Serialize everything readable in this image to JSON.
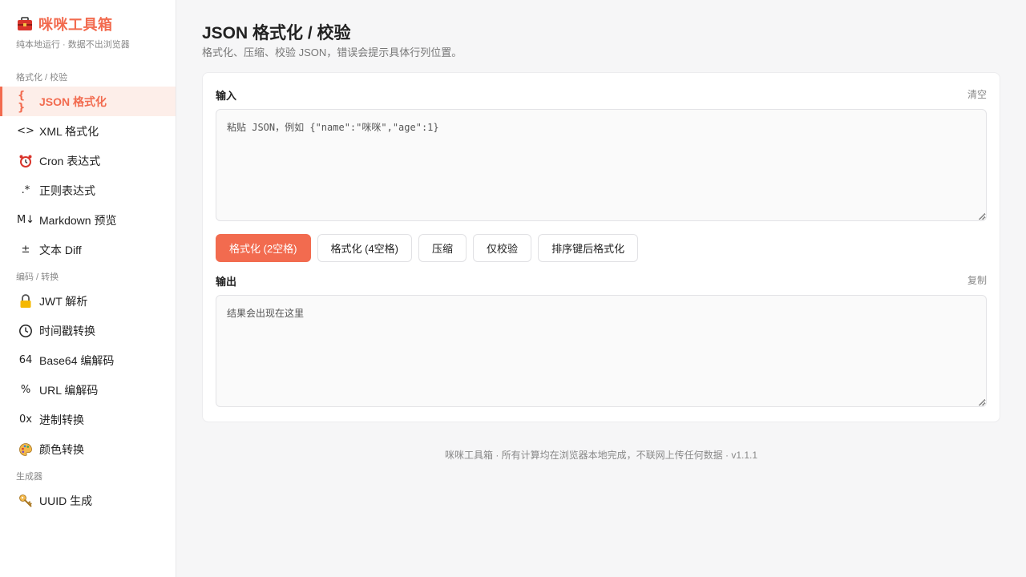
{
  "brand": {
    "title": "咪咪工具箱",
    "subtitle": "纯本地运行 · 数据不出浏览器",
    "icon": "toolbox-icon",
    "accent_color": "#f26b4f"
  },
  "sidebar": {
    "groups": [
      {
        "label": "格式化 / 校验",
        "items": [
          {
            "icon_text": "{ }",
            "icon": "braces-icon",
            "label": "JSON 格式化",
            "active": true
          },
          {
            "icon_text": "<>",
            "icon": "angle-brackets-icon",
            "label": "XML 格式化"
          },
          {
            "icon_text": "⏰",
            "icon": "alarm-clock-icon",
            "label": "Cron 表达式"
          },
          {
            "icon_text": ".*",
            "icon": "regex-icon",
            "label": "正则表达式"
          },
          {
            "icon_text": "M↓",
            "icon": "markdown-icon",
            "label": "Markdown 预览"
          },
          {
            "icon_text": "±",
            "icon": "plus-minus-icon",
            "label": "文本 Diff"
          }
        ]
      },
      {
        "label": "编码 / 转换",
        "items": [
          {
            "icon_text": "🔒",
            "icon": "lock-icon",
            "label": "JWT 解析"
          },
          {
            "icon_text": "🕒",
            "icon": "clock-icon",
            "label": "时间戳转换"
          },
          {
            "icon_text": "64",
            "icon": "base64-icon",
            "label": "Base64 编解码"
          },
          {
            "icon_text": "%",
            "icon": "percent-icon",
            "label": "URL 编解码"
          },
          {
            "icon_text": "0x",
            "icon": "hex-icon",
            "label": "进制转换"
          },
          {
            "icon_text": "🎨",
            "icon": "palette-icon",
            "label": "颜色转换"
          }
        ]
      },
      {
        "label": "生成器",
        "items": [
          {
            "icon_text": "🔑",
            "icon": "key-icon",
            "label": "UUID 生成"
          }
        ]
      }
    ]
  },
  "main": {
    "title": "JSON 格式化 / 校验",
    "description": "格式化、压缩、校验 JSON，错误会提示具体行列位置。",
    "input": {
      "label": "输入",
      "clear_label": "清空",
      "value": "",
      "placeholder": "粘贴 JSON，例如 {\"name\":\"咪咪\",\"age\":1}"
    },
    "buttons": {
      "format2": "格式化 (2空格)",
      "format4": "格式化 (4空格)",
      "minify": "压缩",
      "validate": "仅校验",
      "sort_format": "排序键后格式化"
    },
    "output": {
      "label": "输出",
      "copy_label": "复制",
      "value": "",
      "placeholder": "结果会出现在这里"
    }
  },
  "footer": {
    "text": "咪咪工具箱 · 所有计算均在浏览器本地完成，不联网上传任何数据 · v1.1.1"
  }
}
